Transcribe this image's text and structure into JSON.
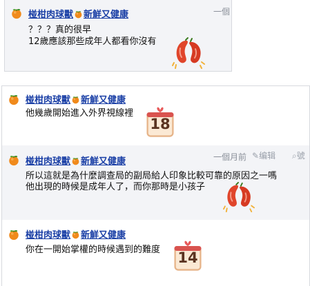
{
  "author": {
    "name": "椪柑肉球獸",
    "tagline": "新鮮又健康"
  },
  "posts": [
    {
      "time": "一個",
      "lines": [
        "？？？真的很早",
        "12歲應該那些成年人都看你沒有"
      ],
      "sticker": "chili-peppers-sticker"
    },
    {
      "lines": [
        "他幾歲開始進入外界視線裡"
      ],
      "sticker": "calendar-18-sticker",
      "sticker_text": "18"
    },
    {
      "time": "一個月前",
      "edit_label": "编辑",
      "more_label": "號",
      "lines": [
        "所以這就是為什麼調查局的副局給人印象比較可靠的原因之一嗎",
        "他出現的時候是成年人了，而你那時是小孩子"
      ],
      "sticker": "chili-peppers-sticker"
    },
    {
      "lines": [
        "你在一開始掌權的時候遇到的難度"
      ],
      "sticker": "calendar-14-sticker",
      "sticker_text": "14"
    }
  ],
  "colors": {
    "author_link": "#1a3fa6",
    "post_bg_alt": "#f3f4f7",
    "border": "#d7d9de",
    "calendar_red": "#d9534f",
    "calendar_body": "#f6d9b8",
    "pepper": "#e0452b"
  }
}
